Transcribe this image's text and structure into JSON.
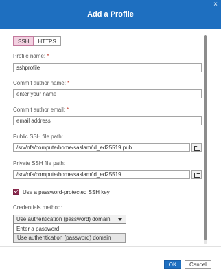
{
  "dialog": {
    "title": "Add a Profile",
    "close_label": "×"
  },
  "tabs": [
    {
      "label": "SSH",
      "active": true
    },
    {
      "label": "HTTPS",
      "active": false
    }
  ],
  "fields": {
    "profile_name": {
      "label": "Profile name:",
      "required_mark": "*",
      "value": "sshprofile"
    },
    "commit_author_name": {
      "label": "Commit author name:",
      "required_mark": "*",
      "placeholder": "enter your name"
    },
    "commit_author_email": {
      "label": "Commit author email:",
      "required_mark": "*",
      "placeholder": "email address"
    },
    "public_ssh": {
      "label": "Public SSH file path:",
      "value": "/srv/nfs/compute/home/saslam/id_ed25519.pub"
    },
    "private_ssh": {
      "label": "Private SSH file path:",
      "value": "/srv/nfs/compute/home/saslam/id_ed25519"
    }
  },
  "password_protected": {
    "label": "Use a password-protected SSH key",
    "checked": true
  },
  "credentials": {
    "label": "Credentials method:",
    "selected": "Use authentication (password) domain",
    "options": [
      "Enter a password",
      "Use authentication (password) domain"
    ]
  },
  "footer": {
    "ok_label": "OK",
    "cancel_label": "Cancel"
  },
  "colors": {
    "title_bar": "#1e6fc0",
    "accent": "#8a2a4e",
    "tab_active": "#f3d1e1"
  },
  "icons": {
    "browse": "folder-icon",
    "close": "close-icon",
    "select": "chevron-down-icon"
  }
}
